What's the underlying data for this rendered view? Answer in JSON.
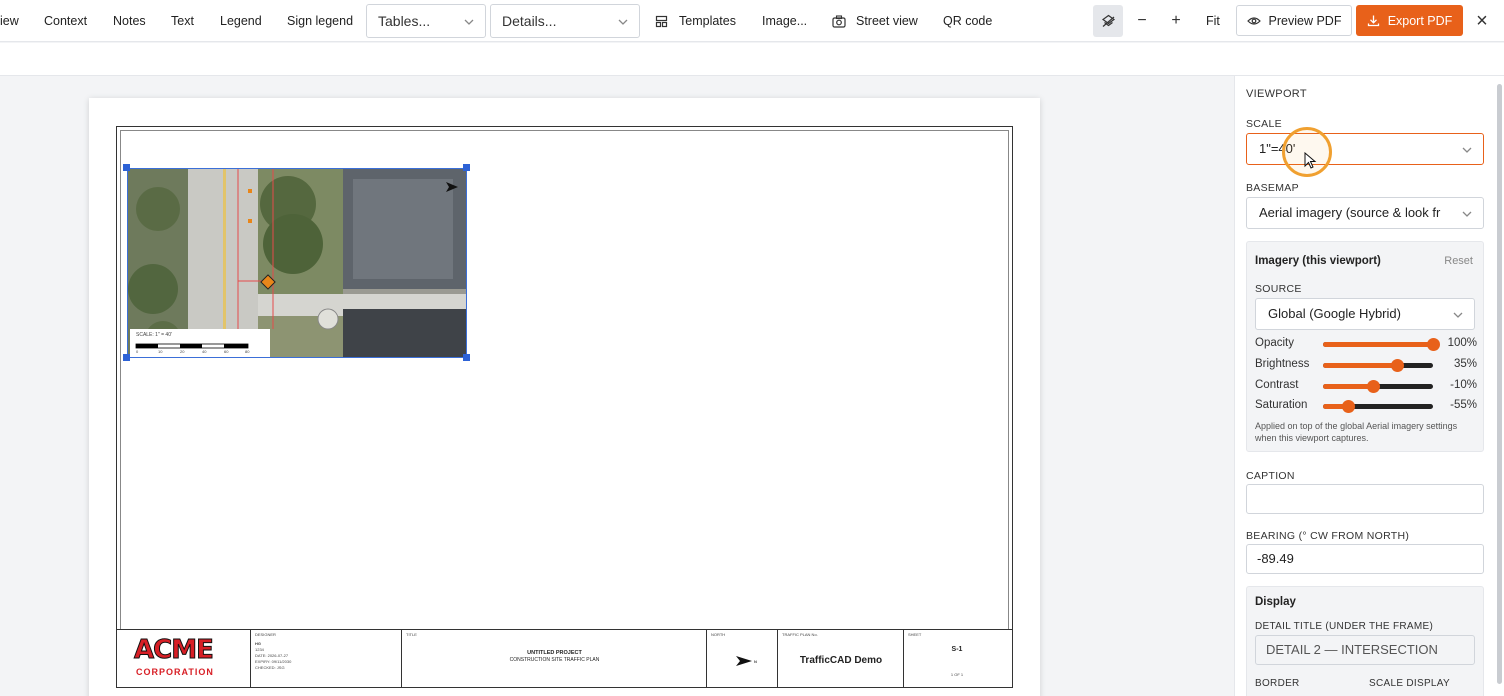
{
  "toolbar": {
    "items": [
      "iew",
      "Context",
      "Notes",
      "Text",
      "Legend",
      "Sign legend"
    ],
    "tables_select": "Tables...",
    "details_select": "Details...",
    "templates": "Templates",
    "image": "Image...",
    "street_view": "Street view",
    "qr_code": "QR code",
    "zoom_out": "−",
    "zoom_in": "+",
    "fit": "Fit",
    "preview_pdf": "Preview PDF",
    "export_pdf": "Export PDF",
    "close": "×"
  },
  "sheet": {
    "viewport_scale_label": "SCALE: 1\" = 40'",
    "scale_bar_ticks": [
      "0",
      "10",
      "20",
      "40",
      "60",
      "80"
    ],
    "titleblock": {
      "logo_top": "ACME",
      "logo_bottom": "CORPORATION",
      "designer_header": "DESIGNER",
      "designer_lines": [
        "HG",
        "1234",
        "DATE: 2026-07-27",
        "EXPIRY: 09/11/2030",
        "CHECKED: JSG"
      ],
      "title_header": "TITLE",
      "title_line1": "UNTITLED PROJECT",
      "title_line2": "CONSTRUCTION SITE TRAFFIC PLAN",
      "north_header": "NORTH",
      "north_label": "N",
      "plan_header": "TRAFFIC PLAN No.",
      "plan_name": "TrafficCAD Demo",
      "sheet_header": "SHEET",
      "sheet_no": "S-1",
      "sheet_of": "1 OF 1"
    }
  },
  "panel": {
    "heading": "VIEWPORT",
    "scale_label": "SCALE",
    "scale_value": "1\"=40'",
    "basemap_label": "BASEMAP",
    "basemap_value": "Aerial imagery (source & look fr",
    "imagery_title": "Imagery (this viewport)",
    "reset": "Reset",
    "source_label": "SOURCE",
    "source_value": "Global (Google Hybrid)",
    "sliders": [
      {
        "label": "Opacity",
        "value": "100%",
        "level": 1.0
      },
      {
        "label": "Brightness",
        "value": "35%",
        "level": 0.675
      },
      {
        "label": "Contrast",
        "value": "-10%",
        "level": 0.45
      },
      {
        "label": "Saturation",
        "value": "-55%",
        "level": 0.225
      }
    ],
    "imagery_note": "Applied on top of the global Aerial imagery settings when this viewport captures.",
    "caption_label": "CAPTION",
    "caption_value": "",
    "bearing_label": "BEARING (° CW FROM NORTH)",
    "bearing_value": "-89.49",
    "display_title": "Display",
    "detail_title_label": "DETAIL TITLE (UNDER THE FRAME)",
    "detail_title_placeholder": "DETAIL 2 — INTERSECTION",
    "border_label": "BORDER",
    "scale_display_label": "SCALE DISPLAY"
  },
  "colors": {
    "accent": "#e8611a",
    "selection": "#2d62d6",
    "logo_red": "#d81f26"
  },
  "icons": [
    "chevron-down-icon",
    "templates-icon",
    "camera-icon",
    "layers-icon",
    "eye-icon",
    "download-icon",
    "close-icon",
    "cursor-icon",
    "north-arrow-icon"
  ]
}
